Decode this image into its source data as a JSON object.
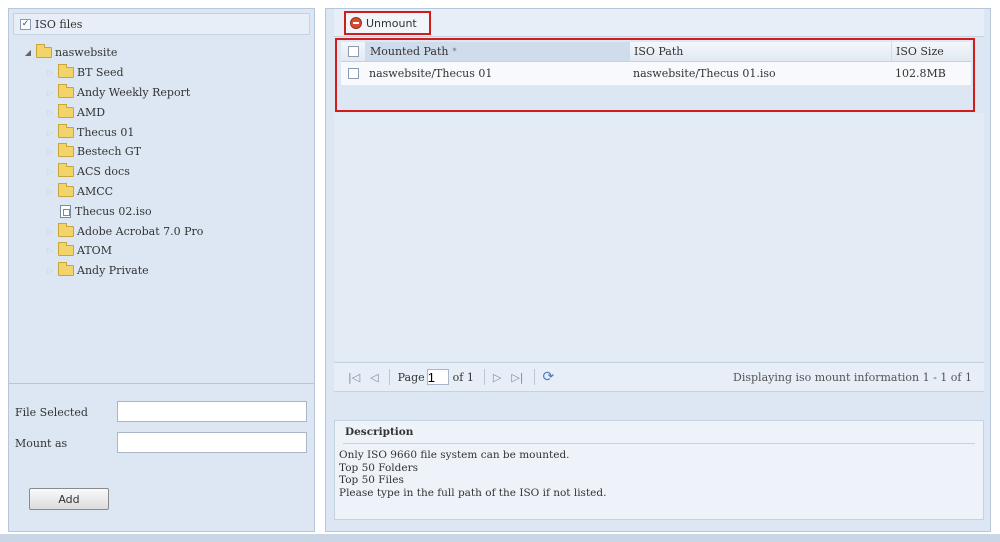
{
  "tree": {
    "root_label": "ISO files",
    "root_checked": true,
    "share": "naswebsite",
    "items": [
      {
        "label": "BT Seed",
        "type": "folder"
      },
      {
        "label": "Andy Weekly Report",
        "type": "folder"
      },
      {
        "label": "AMD",
        "type": "folder"
      },
      {
        "label": "Thecus 01",
        "type": "folder"
      },
      {
        "label": "Bestech GT",
        "type": "folder"
      },
      {
        "label": "ACS docs",
        "type": "folder"
      },
      {
        "label": "AMCC",
        "type": "folder"
      },
      {
        "label": "Thecus 02.iso",
        "type": "file"
      },
      {
        "label": "Adobe Acrobat 7.0 Pro",
        "type": "folder"
      },
      {
        "label": "ATOM",
        "type": "folder"
      },
      {
        "label": "Andy Private",
        "type": "folder"
      }
    ]
  },
  "form": {
    "file_selected_label": "File Selected",
    "file_selected_value": "",
    "mount_as_label": "Mount as",
    "mount_as_value": "",
    "add_label": "Add"
  },
  "toolbar": {
    "unmount_label": "Unmount"
  },
  "table": {
    "columns": [
      "Mounted Path",
      "ISO Path",
      "ISO Size"
    ],
    "sort_indicator": "*",
    "rows": [
      {
        "mounted_path": "naswebsite/Thecus 01",
        "iso_path": "naswebsite/Thecus 01.iso",
        "iso_size": "102.8MB"
      }
    ]
  },
  "pager": {
    "page_label": "Page",
    "page_value": "1",
    "of_label": "of 1",
    "info": "Displaying iso mount information 1 - 1 of 1"
  },
  "description": {
    "title": "Description",
    "lines": [
      "Only ISO 9660 file system can be mounted.",
      "Top 50 Folders",
      "Top 50 Files",
      "Please type in the full path of the ISO if not listed."
    ]
  },
  "colors": {
    "panel_bg": "#dde7f3",
    "highlight_border": "#d11c1c",
    "folder": "#f3d46a"
  }
}
